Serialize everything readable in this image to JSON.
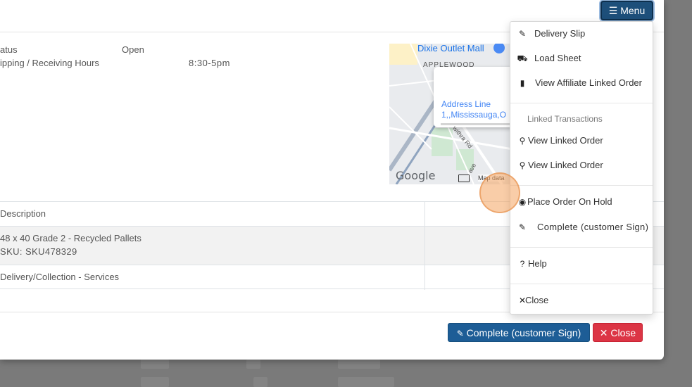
{
  "header": {
    "menu_label": "Menu"
  },
  "info": {
    "status_label": "atus",
    "status_value": "Open",
    "hours_label": "ipping / Receiving Hours",
    "hours_value": "8:30-5pm"
  },
  "map": {
    "place_label": "Dixie Outlet Mall",
    "area_label": "APPLEWOOD",
    "address_text": "Address Line 1,,Mississauga,O",
    "road_label": "withra Rd",
    "road_label_2": "ave",
    "google_label": "Google",
    "map_data_label": "Map data"
  },
  "table": {
    "header_label": "Description",
    "rows": [
      {
        "line1": "48 x 40 Grade 2 - Recycled Pallets",
        "line2": "SKU: SKU478329"
      },
      {
        "line1": "Delivery/Collection - Services"
      }
    ]
  },
  "footer": {
    "complete_label": "Complete (customer Sign)",
    "close_label": "Close"
  },
  "menu": {
    "items": [
      {
        "label": "Delivery Slip",
        "icon": "signature-icon"
      },
      {
        "label": "Load Sheet",
        "icon": "truck-icon"
      },
      {
        "label": "View Affiliate Linked Order",
        "icon": "pdf-icon"
      }
    ],
    "linked_header": "Linked Transactions",
    "linked_items": [
      {
        "label": "View Linked Order",
        "icon": "search-icon"
      },
      {
        "label": "View Linked Order",
        "icon": "search-icon"
      }
    ],
    "hold_label": "Place Order On Hold",
    "complete_label": "Complete (customer Sign)",
    "help_label": "Help",
    "close_label": "Close"
  },
  "colors": {
    "primary": "#1d5d96",
    "danger": "#dc3545",
    "menu_button": "#1d4f7a"
  }
}
